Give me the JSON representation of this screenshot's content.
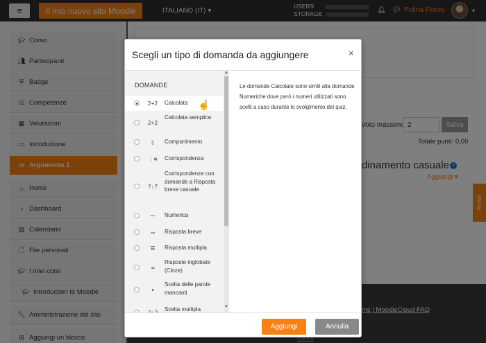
{
  "navbar": {
    "site_name": "Il mio nuovo sito Moodle",
    "language": "ITALIANO (IT)",
    "storage_line1": "USERS",
    "storage_line2": "STORAGE",
    "user_name": "Polina Flores"
  },
  "sidebar": {
    "items": [
      {
        "label": "Corso",
        "icon": "graduation-cap-icon"
      },
      {
        "label": "Partecipanti",
        "icon": "users-icon"
      },
      {
        "label": "Badge",
        "icon": "shield-icon"
      },
      {
        "label": "Competenze",
        "icon": "check-square-icon"
      },
      {
        "label": "Valutazioni",
        "icon": "table-icon"
      },
      {
        "label": "Introduzione",
        "icon": "folder-icon"
      },
      {
        "label": "Argomento 1",
        "icon": "folder-icon"
      },
      {
        "label": "Home",
        "icon": "home-icon"
      },
      {
        "label": "Dashboard",
        "icon": "dashboard-icon"
      },
      {
        "label": "Calendario",
        "icon": "calendar-icon"
      },
      {
        "label": "File personali",
        "icon": "file-icon"
      },
      {
        "label": "I miei corsi",
        "icon": "graduation-cap-icon"
      },
      {
        "label": "Introduction to Moodle",
        "icon": "graduation-cap-icon"
      },
      {
        "label": "Amministrazione del sito",
        "icon": "wrench-icon"
      },
      {
        "label": "Aggiungi un blocco",
        "icon": "plus-square-icon"
      }
    ]
  },
  "background": {
    "voto_label": "Voto massimo",
    "voto_value": "2",
    "salva_label": "Salva",
    "totale_label": "Totale punti: 0,00",
    "ordinamento": "dinamento casuale",
    "aggiungi_label": "Aggiungi",
    "portal_label": "Portal",
    "faq_link": "ms | MoodleCloud FAQ",
    "faq_link2": "credits"
  },
  "modal": {
    "title": "Scegli un tipo di domanda da aggiungere",
    "close": "×",
    "section_header": "DOMANDE",
    "options": [
      {
        "label": "Calcolata",
        "icon": "2+2",
        "selected": true
      },
      {
        "label": "Calcolata semplice",
        "icon": "2+2",
        "selected": false
      },
      {
        "label": "Componimento",
        "icon": "▯",
        "selected": false
      },
      {
        "label": "Corrispondenza",
        "icon": "⋮≡",
        "selected": false
      },
      {
        "label": "Corrispondenze con domande a Risposta breve casuale",
        "icon": "?:?",
        "selected": false
      },
      {
        "label": "Numerica",
        "icon": "ᅲ",
        "selected": false
      },
      {
        "label": "Risposta breve",
        "icon": "▭",
        "selected": false
      },
      {
        "label": "Risposta multipla",
        "icon": "☰",
        "selected": false
      },
      {
        "label": "Risposte inglobate (Cloze)",
        "icon": "≕",
        "selected": false
      },
      {
        "label": "Scelta delle parole mancanti",
        "icon": "▾",
        "selected": false
      },
      {
        "label": "Scelta multipla",
        "icon": "2+2",
        "selected": false
      }
    ],
    "description": "Le domande Calcolate sono simili alla domande Numeriche dove però i numeri utilizzati sono scelti a caso durante lo svolgimento del quiz.",
    "add_button": "Aggiungi",
    "cancel_button": "Annulla"
  }
}
